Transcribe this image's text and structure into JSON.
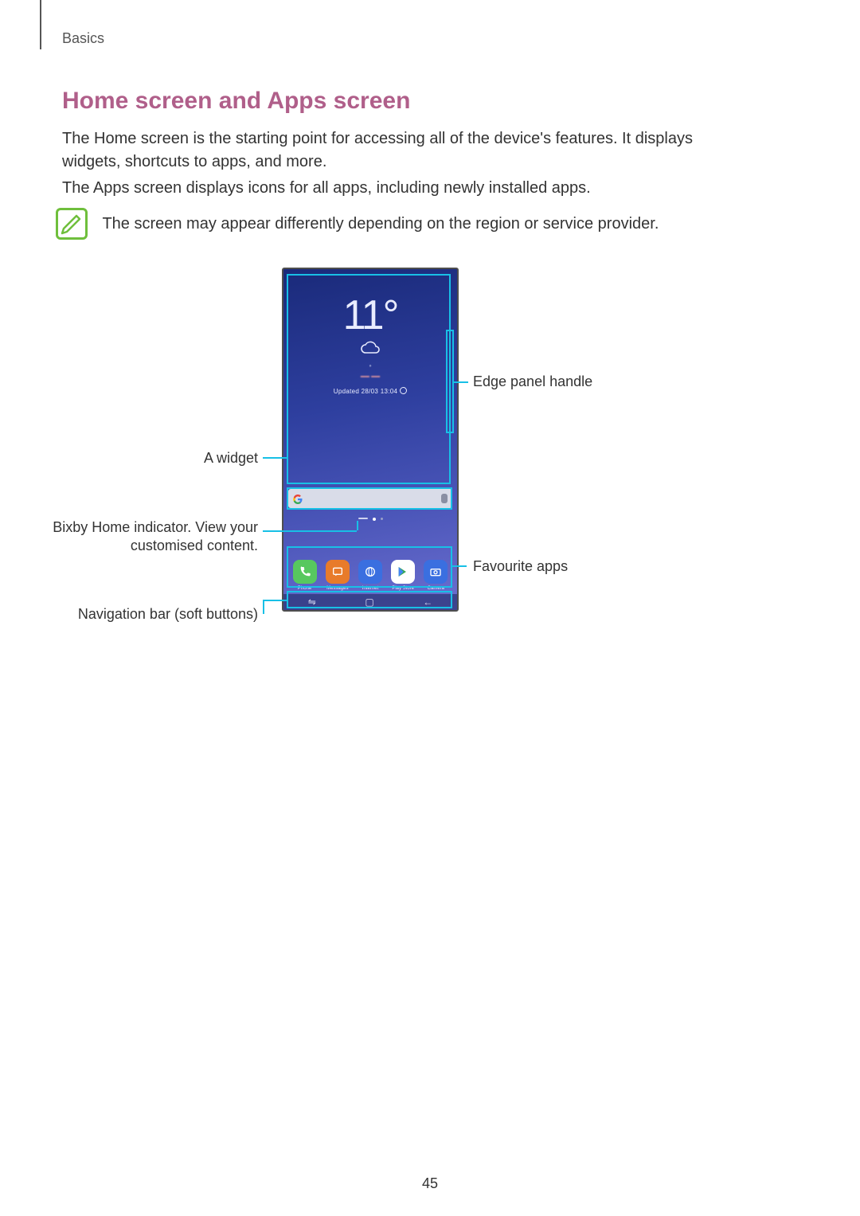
{
  "breadcrumb": "Basics",
  "section_title": "Home screen and Apps screen",
  "para1": "The Home screen is the starting point for accessing all of the device's features. It displays widgets, shortcuts to apps, and more.",
  "para2": "The Apps screen displays icons for all apps, including newly installed apps.",
  "note": "The screen may appear differently depending on the region or service provider.",
  "page_number": "45",
  "phone": {
    "temperature": "11°",
    "updated": "Updated 28/03 13:04",
    "dock": [
      {
        "name": "Phone"
      },
      {
        "name": "Messages"
      },
      {
        "name": "Internet"
      },
      {
        "name": "Play Store"
      },
      {
        "name": "Camera"
      }
    ]
  },
  "callouts": {
    "widget": "A widget",
    "edge": "Edge panel handle",
    "bixby": "Bixby Home indicator. View your customised content.",
    "navbar": "Navigation bar (soft buttons)",
    "favapps": "Favourite apps"
  }
}
